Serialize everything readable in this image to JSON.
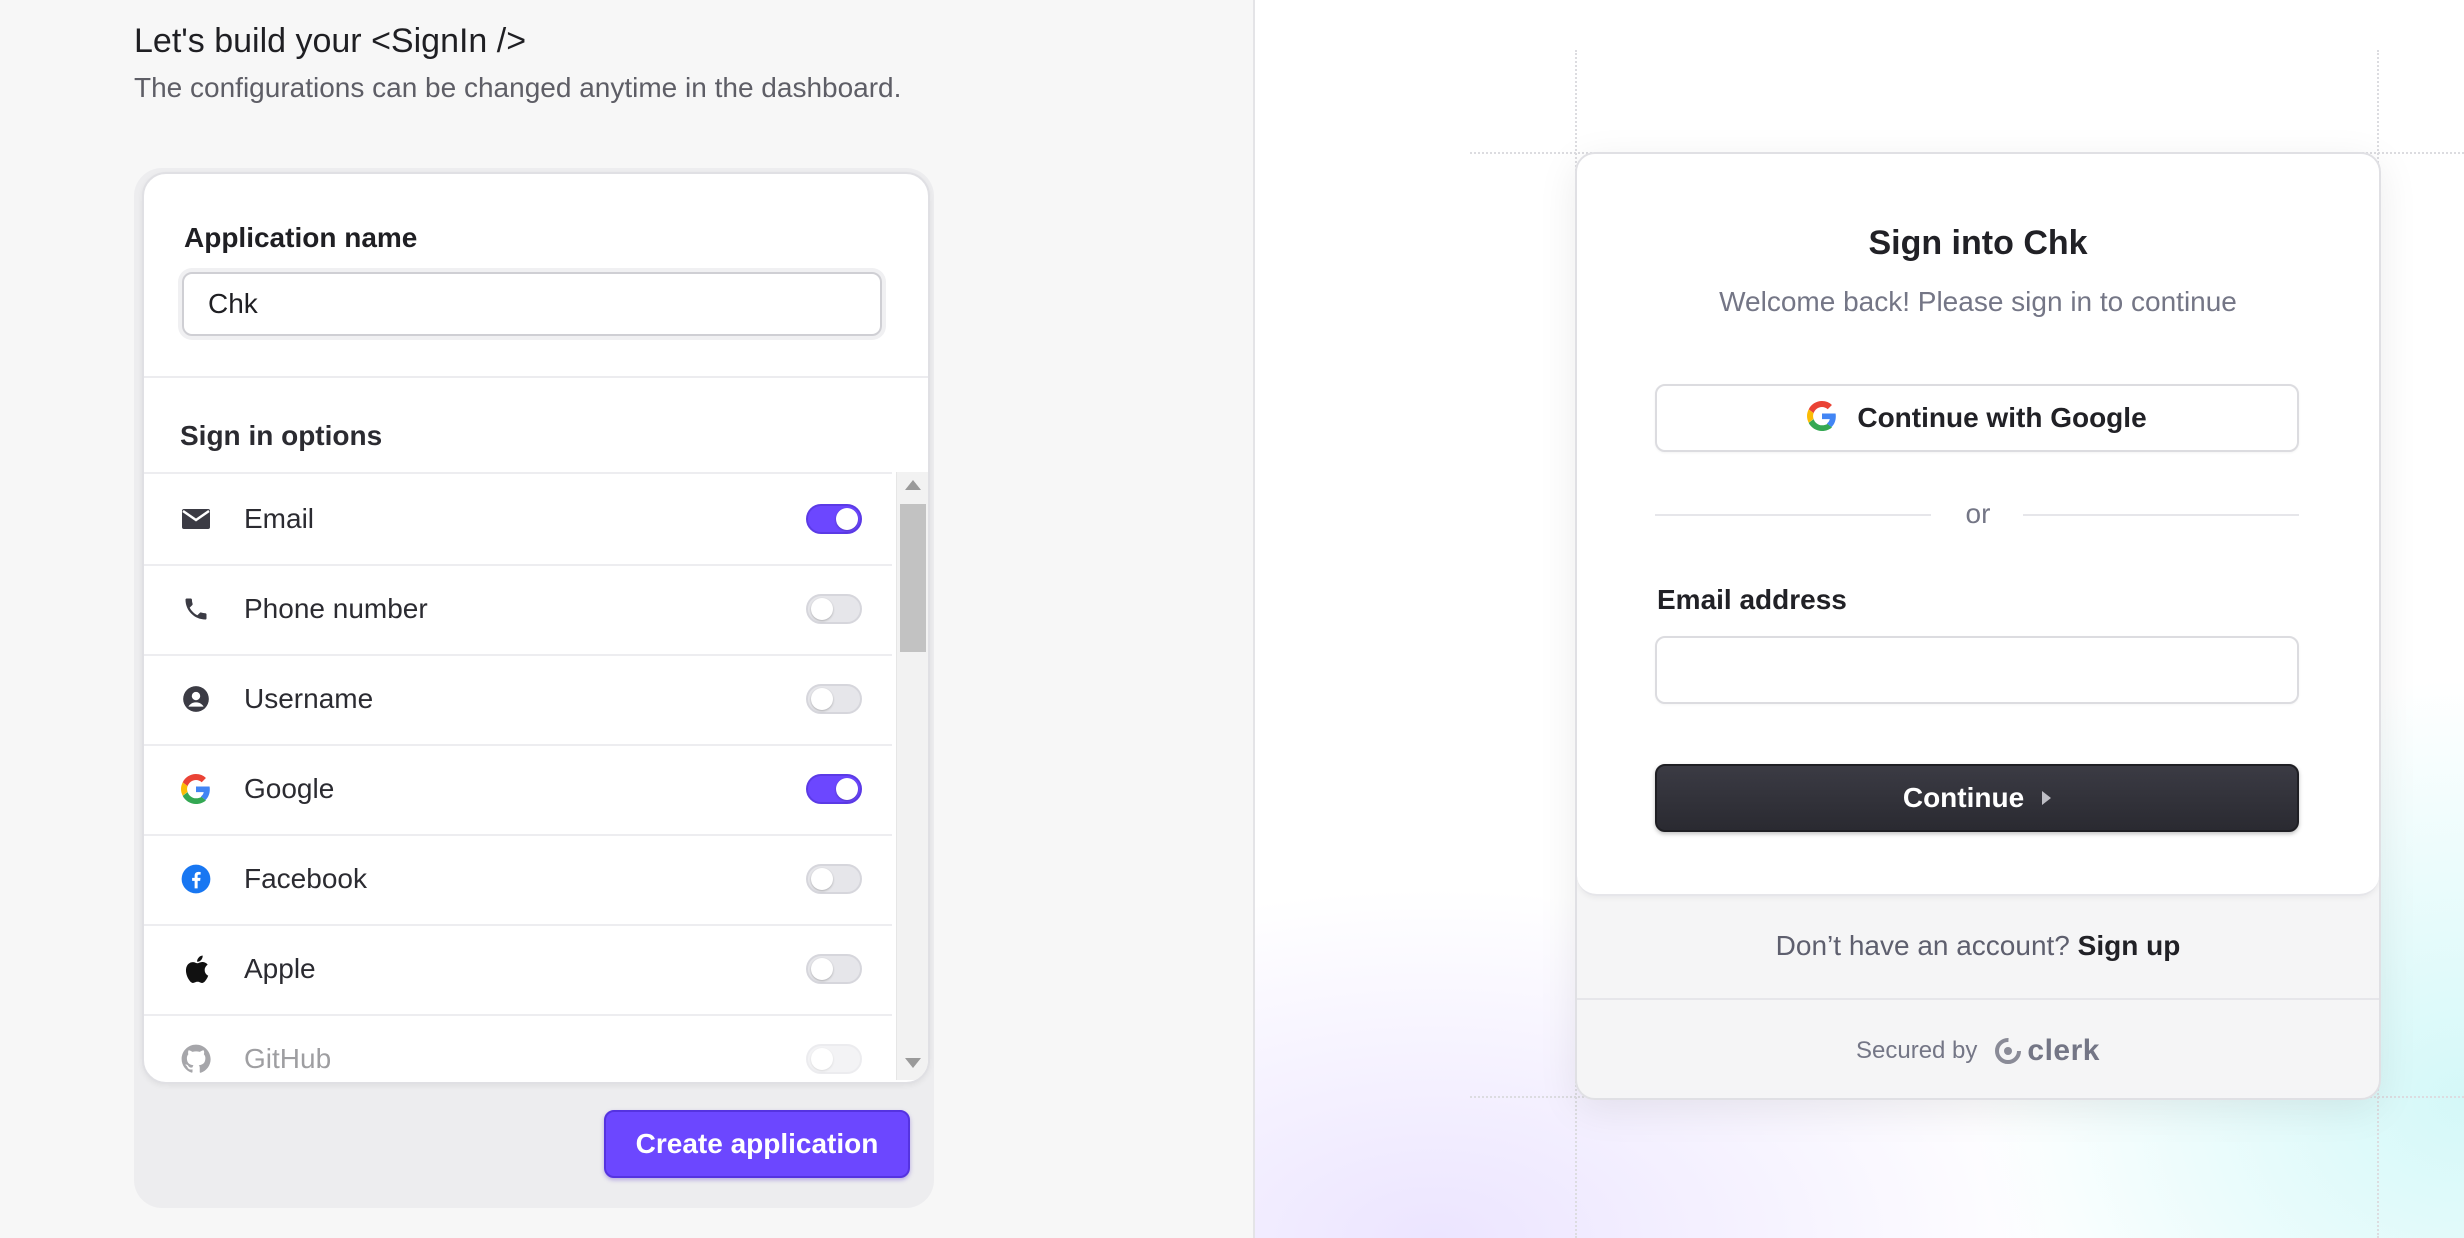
{
  "header": {
    "title": "Let's build your <SignIn />",
    "subtitle": "The configurations can be changed anytime in the dashboard."
  },
  "config": {
    "app_name_label": "Application name",
    "app_name_value": "Chk",
    "sign_in_options_title": "Sign in options",
    "options": [
      {
        "label": "Email",
        "icon": "mail-icon",
        "enabled": true
      },
      {
        "label": "Phone number",
        "icon": "phone-icon",
        "enabled": false
      },
      {
        "label": "Username",
        "icon": "user-circle-icon",
        "enabled": false
      },
      {
        "label": "Google",
        "icon": "google-icon",
        "enabled": true
      },
      {
        "label": "Facebook",
        "icon": "facebook-icon",
        "enabled": false
      },
      {
        "label": "Apple",
        "icon": "apple-icon",
        "enabled": false
      },
      {
        "label": "GitHub",
        "icon": "github-icon",
        "enabled": false
      }
    ],
    "create_button": "Create application"
  },
  "preview": {
    "title": "Sign into Chk",
    "subtitle": "Welcome back! Please sign in to continue",
    "google_button": "Continue with Google",
    "divider_text": "or",
    "email_label": "Email address",
    "email_value": "",
    "continue_button": "Continue",
    "no_account_text": "Don’t have an account?",
    "sign_up_link": "Sign up",
    "secured_by": "Secured by",
    "brand": "clerk"
  },
  "colors": {
    "accent": "#6c47ff",
    "dark_button": "#2f2f37",
    "facebook": "#1877f2"
  }
}
